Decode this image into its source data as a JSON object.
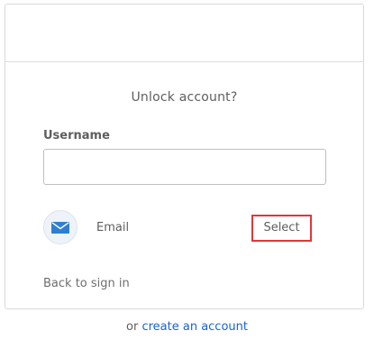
{
  "card": {
    "title": "Unlock account?",
    "username_label": "Username",
    "username_value": "",
    "username_placeholder": "",
    "factor": {
      "icon": "email-envelope-icon",
      "label": "Email",
      "select_label": "Select",
      "highlight_color": "#e0373a"
    },
    "back_link": "Back to sign in"
  },
  "footer": {
    "prefix": "or",
    "link": "create an account"
  },
  "colors": {
    "link": "#1662dd",
    "icon_blue": "#2f7fcf",
    "border": "#d9d9d9"
  }
}
